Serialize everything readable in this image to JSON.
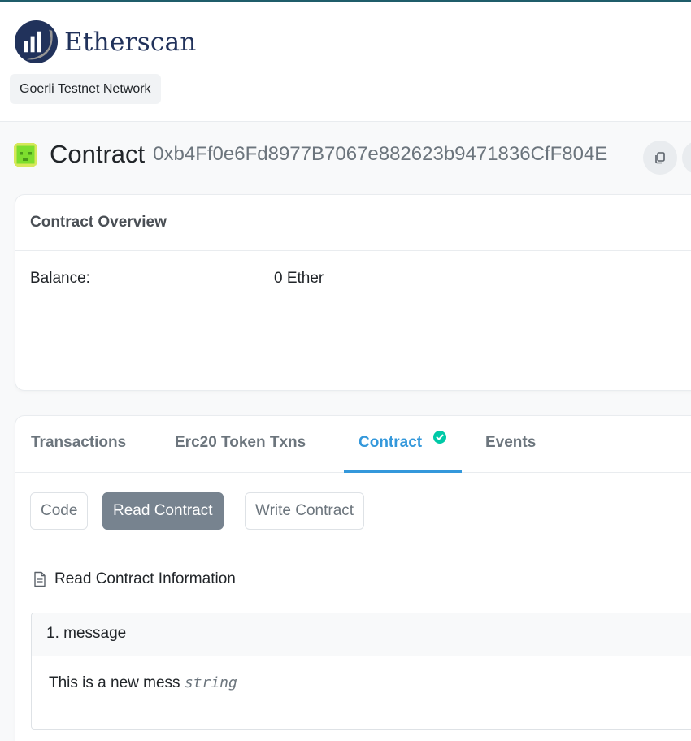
{
  "header": {
    "logo_text": "Etherscan",
    "network_badge": "Goerli Testnet Network"
  },
  "page": {
    "title": "Contract",
    "address": "0xb4Ff0e6Fd8977B7067e882623b9471836CfF804E"
  },
  "overview": {
    "heading": "Contract Overview",
    "balance_label": "Balance:",
    "balance_value": "0 Ether"
  },
  "tabs": {
    "items": [
      "Transactions",
      "Erc20 Token Txns",
      "Contract",
      "Events"
    ],
    "active": "Contract"
  },
  "contract_buttons": {
    "code": "Code",
    "read": "Read Contract",
    "write": "Write Contract",
    "active": "Read Contract"
  },
  "read_section": {
    "title": "Read Contract Information",
    "methods": [
      {
        "label": "1. message",
        "value": "This is a new mess",
        "type": "string"
      }
    ]
  },
  "colors": {
    "accent": "#3498db",
    "verified": "#00c9a7",
    "active_button": "#77838f",
    "identicon": "#7dde2e",
    "brand_navy": "#21325b"
  },
  "icons": {
    "logo": "etherscan-logo-icon",
    "identicon": "contract-identicon",
    "copy": "copy-icon",
    "verified": "check-circle-icon",
    "document": "file-text-icon"
  }
}
